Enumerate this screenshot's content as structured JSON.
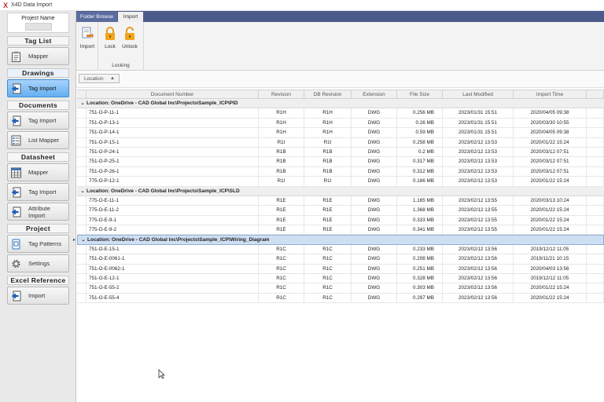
{
  "app": {
    "logo": "X",
    "title": "X4D Data Import"
  },
  "sidebar": {
    "project_name_label": "Project Name",
    "sections": [
      {
        "title": "Tag List",
        "buttons": [
          {
            "label": "Mapper",
            "icon": "clipboard-icon"
          }
        ]
      },
      {
        "title": "Drawings",
        "active": true,
        "buttons": [
          {
            "label": "Tag Import",
            "icon": "arrow-import-icon",
            "active": true
          }
        ]
      },
      {
        "title": "Documents",
        "buttons": [
          {
            "label": "Tag Import",
            "icon": "arrow-import-icon"
          },
          {
            "label": "List Mapper",
            "icon": "list-icon"
          }
        ]
      },
      {
        "title": "Datasheet",
        "buttons": [
          {
            "label": "Mapper",
            "icon": "grid-icon"
          },
          {
            "label": "Tag Import",
            "icon": "arrow-import-icon"
          },
          {
            "label": "Attribute Import",
            "icon": "arrow-import-icon"
          }
        ]
      },
      {
        "title": "Project",
        "buttons": [
          {
            "label": "Tag Patterns",
            "icon": "tag-pattern-icon"
          },
          {
            "label": "Settings",
            "icon": "gear-icon"
          }
        ]
      },
      {
        "title": "Excel Reference",
        "buttons": [
          {
            "label": "Import",
            "icon": "arrow-import-icon"
          }
        ]
      }
    ]
  },
  "ribbon": {
    "tabs": [
      "Folder Browse",
      "Import"
    ],
    "import_button": "Import",
    "lock_button": "Lock",
    "unlock_button": "Unlock",
    "locking_group": "Locking"
  },
  "groupby": {
    "chip": "Location"
  },
  "grid": {
    "columns": [
      "Document Number",
      "Revision",
      "DB Revision",
      "Extension",
      "File Size",
      "Last Modified",
      "Import Time"
    ],
    "groups": [
      {
        "label": "Location: OneDrive - CAD Global Inc\\Projects\\Sample_ICP\\PID",
        "rows": [
          [
            "751-O-P-11-1",
            "R1H",
            "R1H",
            "DWG",
            "0.256 MB",
            "2023/01/31 15:51",
            "2020/04/05 09:38"
          ],
          [
            "751-O-P-13-1",
            "R1H",
            "R1H",
            "DWG",
            "0.26 MB",
            "2023/01/31 15:51",
            "2020/03/30 10:55"
          ],
          [
            "751-O-P-14-1",
            "R1H",
            "R1H",
            "DWG",
            "0.59 MB",
            "2023/01/31 15:51",
            "2020/04/05 09:38"
          ],
          [
            "751-O-P-15-1",
            "R1I",
            "R1I",
            "DWG",
            "0.258 MB",
            "2023/02/12 13:53",
            "2020/01/22 15:24"
          ],
          [
            "751-O-P-24-1",
            "R1B",
            "R1B",
            "DWG",
            "0.2 MB",
            "2023/02/12 13:53",
            "2020/03/12 07:51"
          ],
          [
            "751-O-P-25-1",
            "R1B",
            "R1B",
            "DWG",
            "0.317 MB",
            "2023/02/12 13:53",
            "2020/03/12 07:51"
          ],
          [
            "751-O-P-26-1",
            "R1B",
            "R1B",
            "DWG",
            "0.312 MB",
            "2023/02/12 13:53",
            "2020/03/12 07:51"
          ],
          [
            "775-O-P-12-1",
            "R1I",
            "R1I",
            "DWG",
            "0.166 MB",
            "2023/02/12 13:53",
            "2020/01/22 15:24"
          ]
        ]
      },
      {
        "label": "Location: OneDrive - CAD Global Inc\\Projects\\Sample_ICP\\SLD",
        "rows": [
          [
            "775-O-E-11-1",
            "R1E",
            "R1E",
            "DWG",
            "1.165 MB",
            "2023/02/12 13:55",
            "2020/03/13 10:24"
          ],
          [
            "775-O-E-11-2",
            "R1E",
            "R1E",
            "DWG",
            "1.368 MB",
            "2023/02/12 13:55",
            "2020/01/22 15:24"
          ],
          [
            "775-O-E-9-1",
            "R1E",
            "R1E",
            "DWG",
            "0.333 MB",
            "2023/02/12 13:55",
            "2020/01/22 15:24"
          ],
          [
            "775-O-E-9-2",
            "R1E",
            "R1E",
            "DWG",
            "0.341 MB",
            "2023/02/12 13:55",
            "2020/01/22 15:24"
          ]
        ]
      },
      {
        "label": "Location: OneDrive - CAD Global Inc\\Projects\\Sample_ICP\\Wiring_Diagram",
        "selected": true,
        "rows": [
          [
            "751-O-E-15-1",
            "R1C",
            "R1C",
            "DWG",
            "0.233 MB",
            "2023/02/12 13:56",
            "2019/12/12 11:05"
          ],
          [
            "751-O-E-0061-1",
            "R1C",
            "R1C",
            "DWG",
            "0.208 MB",
            "2023/02/12 13:56",
            "2019/11/21 10:15"
          ],
          [
            "751-O-E-0062-1",
            "R1C",
            "R1C",
            "DWG",
            "0.251 MB",
            "2023/02/12 13:56",
            "2020/04/03 13:56"
          ],
          [
            "751-O-E-12-1",
            "R1C",
            "R1C",
            "DWG",
            "0.328 MB",
            "2023/02/12 13:56",
            "2019/12/12 11:05"
          ],
          [
            "751-O-E-55-2",
            "R1C",
            "R1C",
            "DWG",
            "0.303 MB",
            "2023/02/12 13:56",
            "2020/01/22 15:24"
          ],
          [
            "751-O-E-55-4",
            "R1C",
            "R1C",
            "DWG",
            "0.297 MB",
            "2023/02/12 13:56",
            "2020/01/22 15:24"
          ]
        ]
      }
    ]
  }
}
